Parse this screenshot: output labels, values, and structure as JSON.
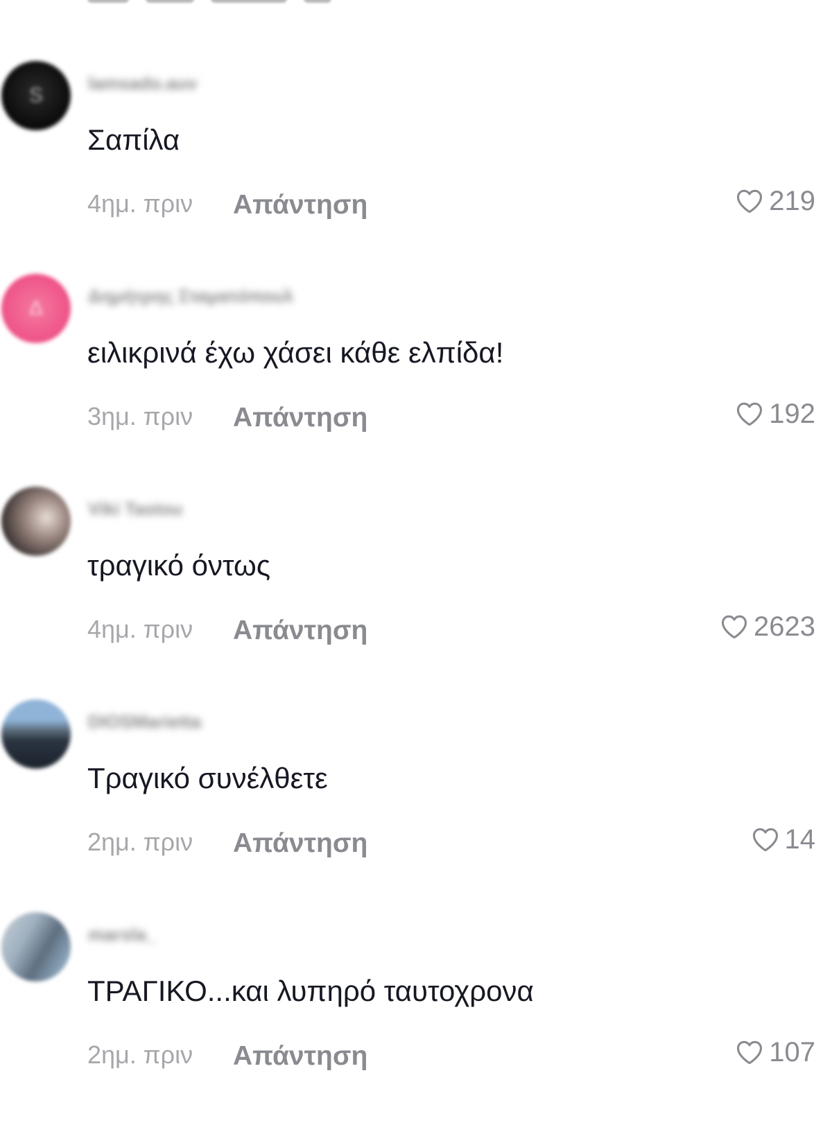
{
  "comments": [
    {
      "username": "lamsado.auv",
      "avatar_color": "#0f0f0f",
      "avatar_letter": "S",
      "text": "Σαπίλα",
      "time": "4ημ. πριν",
      "reply_label": "Απάντηση",
      "likes": "219",
      "like_icon": "heart-outline-icon"
    },
    {
      "username": "Δημήτρης Σταματόπουλ",
      "avatar_color": "#f0588a",
      "avatar_letter": "Δ",
      "text": "ειλικρινά έχω χάσει κάθε ελπίδα!",
      "time": "3ημ. πριν",
      "reply_label": "Απάντηση",
      "likes": "192",
      "like_icon": "heart-outline-icon"
    },
    {
      "username": "Viki Tastou",
      "avatar_color": "#6b5b55",
      "avatar_letter": "",
      "text": "τραγικό όντως",
      "time": "4ημ. πριν",
      "reply_label": "Απάντηση",
      "likes": "2623",
      "like_icon": "heart-outline-icon"
    },
    {
      "username": "DIOSMarietta",
      "avatar_color": "#4a5a6e",
      "avatar_letter": "",
      "text": "Τραγικό συνέλθετε",
      "time": "2ημ. πριν",
      "reply_label": "Απάντηση",
      "likes": "14",
      "like_icon": "heart-outline-icon"
    },
    {
      "username": "marsla_",
      "avatar_color": "#7d8fa0",
      "avatar_letter": "",
      "text": "ΤΡΑΓΙΚΟ...και λυπηρό ταυτοχρονα",
      "time": "2ημ. πριν",
      "reply_label": "Απάντηση",
      "likes": "107",
      "like_icon": "heart-outline-icon"
    }
  ]
}
